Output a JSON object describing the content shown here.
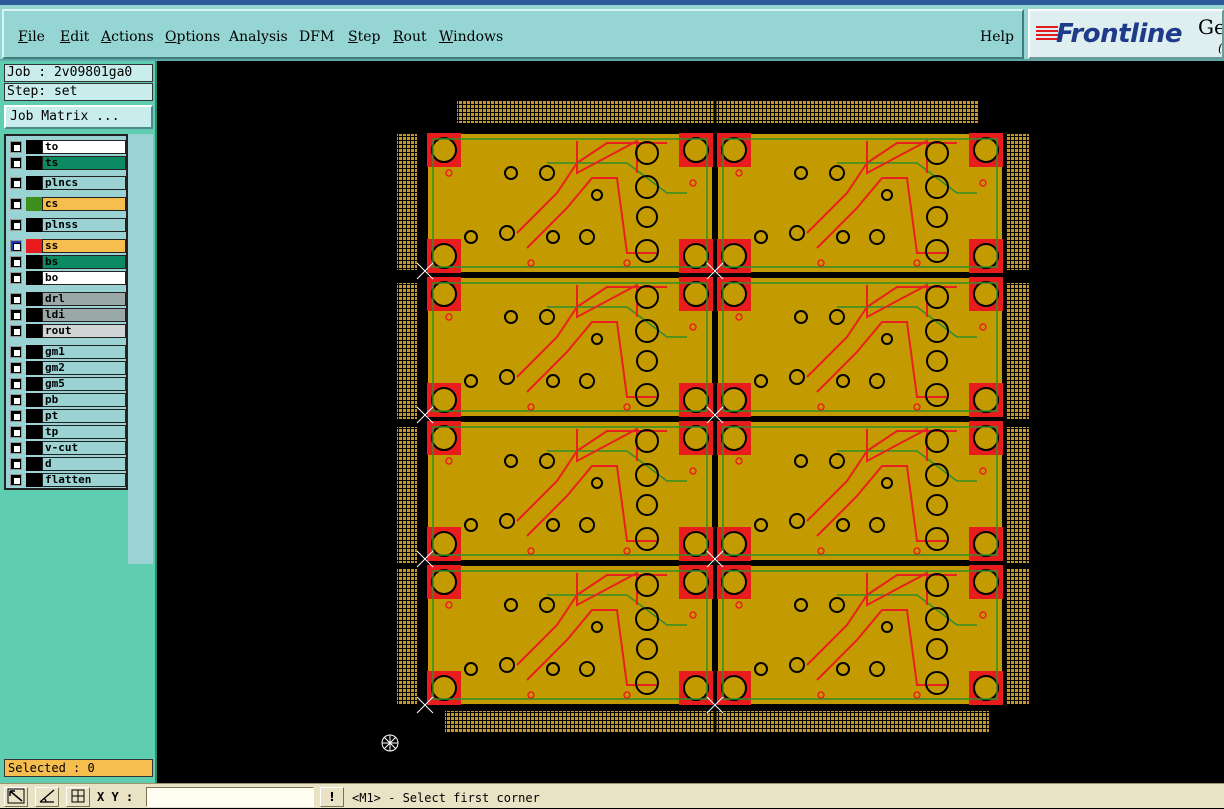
{
  "menu": {
    "items": [
      "File",
      "Edit",
      "Actions",
      "Options",
      "Analysis",
      "DFM",
      "Step",
      "Rout",
      "Windows"
    ],
    "help": "Help"
  },
  "logo": {
    "brand": "Frontline",
    "suffix": "Ge",
    "sub": "("
  },
  "job": {
    "job_label": "Job : 2v09801ga0",
    "step_label": "Step: set",
    "job_matrix_label": "Job Matrix ..."
  },
  "layers": [
    {
      "name": "to",
      "swatch": "#000000",
      "bg": "#ffffff"
    },
    {
      "name": "ts",
      "swatch": "#000000",
      "bg": "#0c8a62"
    },
    {
      "name": "plncs",
      "swatch": "#000000",
      "bg": "#9bd3d5"
    },
    {
      "name": "cs",
      "swatch": "#3f8f1f",
      "bg": "#f6bd4f"
    },
    {
      "name": "plnss",
      "swatch": "#000000",
      "bg": "#9bd3d5"
    },
    {
      "name": "ss",
      "swatch": "#e81c1c",
      "bg": "#f6bd4f",
      "active": true
    },
    {
      "name": "bs",
      "swatch": "#000000",
      "bg": "#0c8a62"
    },
    {
      "name": "bo",
      "swatch": "#000000",
      "bg": "#ffffff"
    },
    {
      "name": "drl",
      "swatch": "#000000",
      "bg": "#9aa8a8"
    },
    {
      "name": "ldi",
      "swatch": "#000000",
      "bg": "#9aa8a8"
    },
    {
      "name": "rout",
      "swatch": "#000000",
      "bg": "#d0d4d4"
    },
    {
      "name": "gm1",
      "swatch": "#000000",
      "bg": "#9bd3d5"
    },
    {
      "name": "gm2",
      "swatch": "#000000",
      "bg": "#9bd3d5"
    },
    {
      "name": "gm5",
      "swatch": "#000000",
      "bg": "#9bd3d5"
    },
    {
      "name": "pb",
      "swatch": "#000000",
      "bg": "#9bd3d5"
    },
    {
      "name": "pt",
      "swatch": "#000000",
      "bg": "#9bd3d5"
    },
    {
      "name": "tp",
      "swatch": "#000000",
      "bg": "#9bd3d5"
    },
    {
      "name": "v-cut",
      "swatch": "#000000",
      "bg": "#9bd3d5"
    },
    {
      "name": "d",
      "swatch": "#000000",
      "bg": "#9bd3d5"
    },
    {
      "name": "flatten",
      "swatch": "#000000",
      "bg": "#9bd3d5"
    }
  ],
  "selected_label": "Selected : 0",
  "status": {
    "xy_label": "X Y :",
    "xy_value": "",
    "prompt": "<M1> - Select first corner",
    "alert_button": "!"
  },
  "board": {
    "panels_cols": 2,
    "panels_rows": 4,
    "copper": "#c39a00",
    "pad_red": "#e81c1c",
    "trace_red": "#e82020",
    "trace_green": "#2f8f2a",
    "frame_dots": "#c9962a"
  }
}
